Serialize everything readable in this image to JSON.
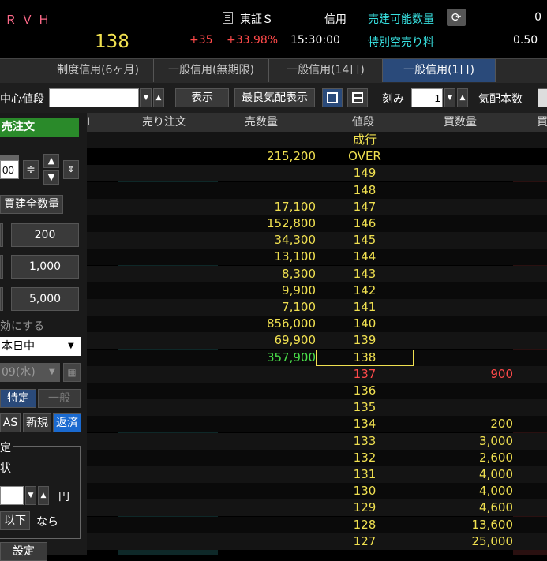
{
  "header": {
    "symbol": "ＲＶＨ",
    "price": "138",
    "exchange": "東証Ｓ",
    "margin_label": "信用",
    "available_qty_label": "売建可能数量",
    "available_qty_value": "0",
    "change": "+35",
    "change_pct": "+33.98%",
    "time": "15:30:00",
    "short_fee_label": "特別空売り料",
    "short_fee_value": "0.50"
  },
  "tabs": [
    {
      "label": "制度信用(6ヶ月)"
    },
    {
      "label": "一般信用(無期限)"
    },
    {
      "label": "一般信用(14日)"
    },
    {
      "label": "一般信用(1日)",
      "active": true
    }
  ],
  "controls": {
    "center_price_label": "中心値段",
    "center_price_value": "",
    "display_button": "表示",
    "best_quote_button": "最良気配表示",
    "tick_label": "刻み",
    "tick_value": "1",
    "quote_count_label": "気配本数"
  },
  "left_panel": {
    "sell_order_title": "売注文",
    "qty_value": "00",
    "close_all_button": "買建全数量",
    "qty_buttons": [
      "200",
      "1,000",
      "5,000"
    ],
    "invalid_text": "効にする",
    "period_select": "本日中",
    "date_select": "09(水)",
    "account_special": "特定",
    "account_general": "一般",
    "order_type_as": "AS",
    "order_type_new": "新規",
    "order_type_close": "返済",
    "section_label": "定",
    "cond_label": "状",
    "yen_label": "円",
    "below_button": "以下",
    "then_label": "なら",
    "setting_button": "設定"
  },
  "grid": {
    "headers": {
      "left_cut": "I",
      "sell_order": "売り注文",
      "sell_qty": "売数量",
      "price": "値段",
      "buy_qty": "買数量",
      "buy_cut": "買"
    },
    "rows": [
      {
        "sell_qty": "",
        "price": "成行",
        "buy_qty": ""
      },
      {
        "sell_qty": "215,200",
        "price": "OVER",
        "buy_qty": ""
      },
      {
        "sell_qty": "",
        "price": "149",
        "buy_qty": ""
      },
      {
        "sell_qty": "",
        "price": "148",
        "buy_qty": ""
      },
      {
        "sell_qty": "17,100",
        "price": "147",
        "buy_qty": ""
      },
      {
        "sell_qty": "152,800",
        "price": "146",
        "buy_qty": ""
      },
      {
        "sell_qty": "34,300",
        "price": "145",
        "buy_qty": ""
      },
      {
        "sell_qty": "13,100",
        "price": "144",
        "buy_qty": ""
      },
      {
        "sell_qty": "8,300",
        "price": "143",
        "buy_qty": ""
      },
      {
        "sell_qty": "9,900",
        "price": "142",
        "buy_qty": ""
      },
      {
        "sell_qty": "7,100",
        "price": "141",
        "buy_qty": ""
      },
      {
        "sell_qty": "856,000",
        "price": "140",
        "buy_qty": ""
      },
      {
        "sell_qty": "69,900",
        "price": "139",
        "buy_qty": ""
      },
      {
        "sell_qty": "357,900",
        "price": "138",
        "buy_qty": "",
        "current": true
      },
      {
        "sell_qty": "",
        "price": "137",
        "buy_qty": "900",
        "red": true
      },
      {
        "sell_qty": "",
        "price": "136",
        "buy_qty": ""
      },
      {
        "sell_qty": "",
        "price": "135",
        "buy_qty": ""
      },
      {
        "sell_qty": "",
        "price": "134",
        "buy_qty": "200"
      },
      {
        "sell_qty": "",
        "price": "133",
        "buy_qty": "3,000"
      },
      {
        "sell_qty": "",
        "price": "132",
        "buy_qty": "2,600"
      },
      {
        "sell_qty": "",
        "price": "131",
        "buy_qty": "4,000"
      },
      {
        "sell_qty": "",
        "price": "130",
        "buy_qty": "4,000"
      },
      {
        "sell_qty": "",
        "price": "129",
        "buy_qty": "4,600"
      },
      {
        "sell_qty": "",
        "price": "128",
        "buy_qty": "13,600"
      },
      {
        "sell_qty": "",
        "price": "127",
        "buy_qty": "25,000"
      }
    ]
  },
  "colors": {
    "price_text": "#f0e050",
    "current_sell_text": "#4ae04a",
    "down_text": "#ff4a4a",
    "label_cyan": "#38e0e0",
    "active_tab": "#2a4a7a",
    "sell_title_bg": "#2a8a2a"
  }
}
